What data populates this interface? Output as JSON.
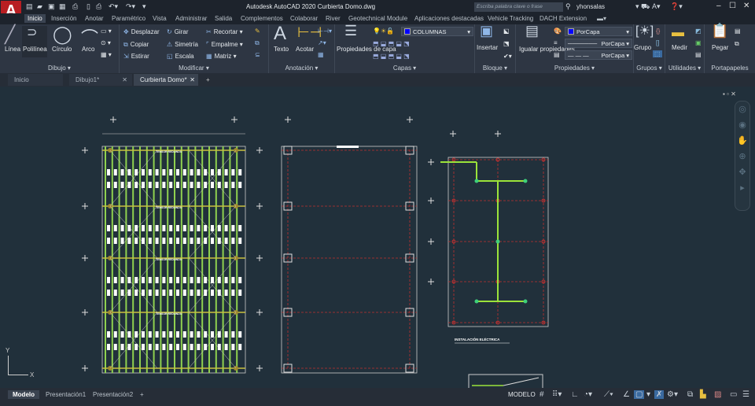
{
  "titlebar": {
    "title": "Autodesk AutoCAD 2020   Curbierta Domo.dwg",
    "search_placeholder": "Escriba palabra clave o frase",
    "user": "yhonsalas",
    "logo": "A"
  },
  "ribbon_tabs": [
    "Inicio",
    "Inserción",
    "Anotar",
    "Paramétrico",
    "Vista",
    "Administrar",
    "Salida",
    "Complementos",
    "Colaborar",
    "River",
    "Geotechnical Module",
    "Aplicaciones destacadas",
    "Vehicle Tracking",
    "DACH Extension"
  ],
  "panels": {
    "dibujo": {
      "label": "Dibujo ▾",
      "tools": [
        "Línea",
        "Polilínea",
        "Círculo",
        "Arco"
      ]
    },
    "modificar": {
      "label": "Modificar ▾",
      "tools": [
        "Desplazar",
        "Girar",
        "Recortar",
        "Copiar",
        "Simetría",
        "Empalme",
        "Estirar",
        "Escala",
        "Matriz"
      ]
    },
    "anotacion": {
      "label": "Anotación ▾",
      "tools": [
        "Texto",
        "Acotar"
      ]
    },
    "capas": {
      "label": "Capas ▾",
      "tool": "Propiedades de capa",
      "layer": "COLUMNAS"
    },
    "bloque": {
      "label": "Bloque ▾",
      "tool": "Insertar"
    },
    "propiedades": {
      "label": "Propiedades ▾",
      "tool": "Igualar propiedades",
      "color": "PorCapa",
      "lineweight": "PorCapa",
      "linetype": "PorCapa"
    },
    "grupos": {
      "label": "Grupos ▾",
      "tool": "Grupo"
    },
    "utilidades": {
      "label": "Utilidades ▾",
      "tool": "Medir"
    },
    "portapapeles": {
      "label": "Portapapeles",
      "tool": "Pegar"
    }
  },
  "doc_tabs": [
    "Inicio",
    "Dibujo1*",
    "Curbierta Domo*"
  ],
  "drawing": {
    "label_tensor": "TENSOR REDONDO",
    "label_electrica": "INSTALACIÓN ELÉCTRICA",
    "ucs_x": "X",
    "ucs_y": "Y"
  },
  "layout_tabs": [
    "Modelo",
    "Presentación1",
    "Presentación2"
  ],
  "status": {
    "mode": "MODELO"
  },
  "colors": {
    "green": "#8fd14f",
    "yellow": "#c9c040",
    "red": "#c03030",
    "bg": "#21303b"
  }
}
